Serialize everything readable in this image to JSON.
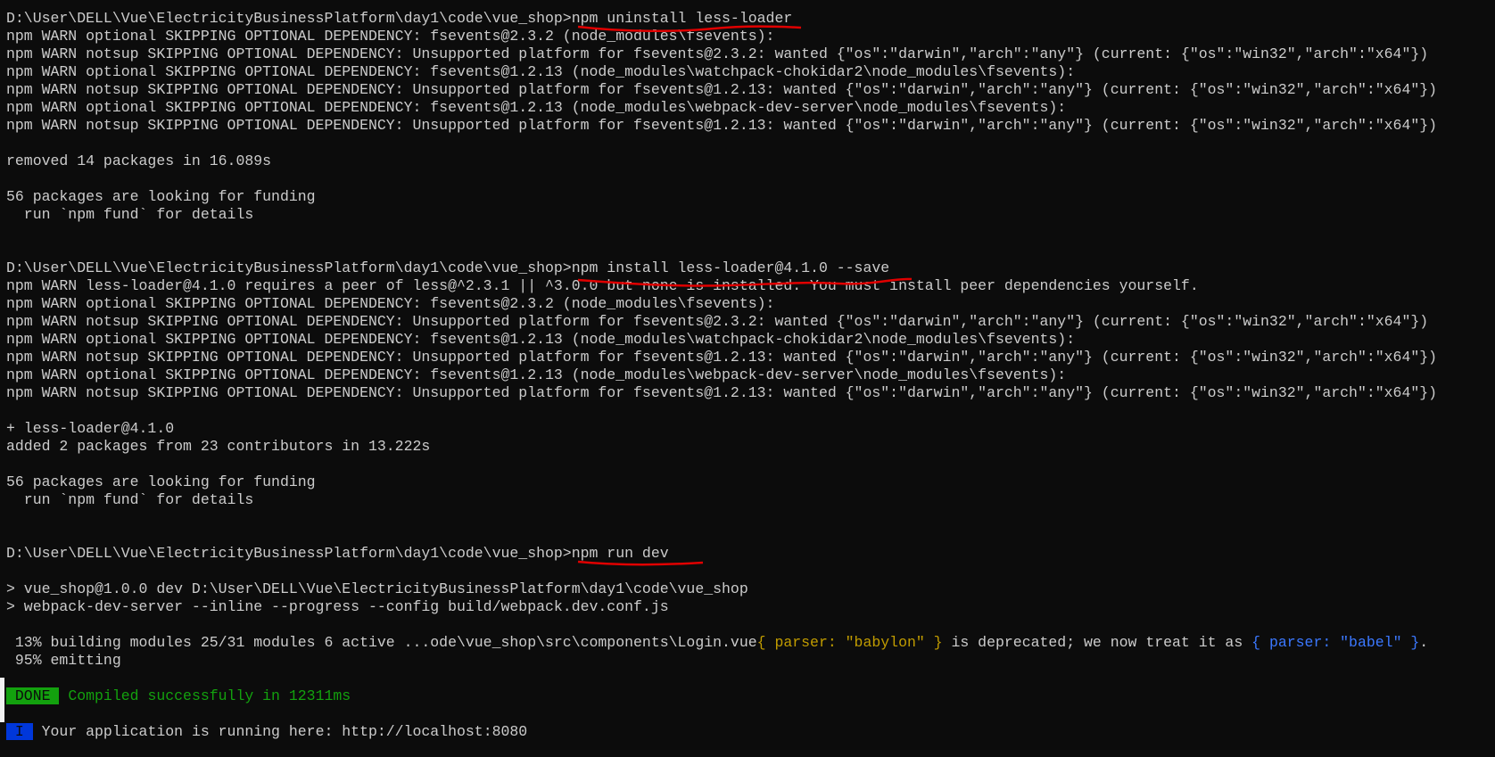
{
  "terminal": {
    "colors": {
      "background": "#0c0c0c",
      "foreground": "#cccccc",
      "yellow": "#c19c00",
      "blue": "#3b78ff",
      "green": "#13a10e",
      "done_badge": "#13a10e",
      "info_badge": "#0037da",
      "annotation": "#e00000"
    },
    "lines": [
      [
        {
          "t": "D:\\User\\DELL\\Vue\\ElectricityBusinessPlatform\\day1\\code\\vue_shop>npm uninstall less-loader"
        }
      ],
      [
        {
          "t": "npm WARN optional SKIPPING OPTIONAL DEPENDENCY: fsevents@2.3.2 (node_modules\\fsevents):"
        }
      ],
      [
        {
          "t": "npm WARN notsup SKIPPING OPTIONAL DEPENDENCY: Unsupported platform for fsevents@2.3.2: wanted {\"os\":\"darwin\",\"arch\":\"any\"} (current: {\"os\":\"win32\",\"arch\":\"x64\"})"
        }
      ],
      [
        {
          "t": "npm WARN optional SKIPPING OPTIONAL DEPENDENCY: fsevents@1.2.13 (node_modules\\watchpack-chokidar2\\node_modules\\fsevents):"
        }
      ],
      [
        {
          "t": "npm WARN notsup SKIPPING OPTIONAL DEPENDENCY: Unsupported platform for fsevents@1.2.13: wanted {\"os\":\"darwin\",\"arch\":\"any\"} (current: {\"os\":\"win32\",\"arch\":\"x64\"})"
        }
      ],
      [
        {
          "t": "npm WARN optional SKIPPING OPTIONAL DEPENDENCY: fsevents@1.2.13 (node_modules\\webpack-dev-server\\node_modules\\fsevents):"
        }
      ],
      [
        {
          "t": "npm WARN notsup SKIPPING OPTIONAL DEPENDENCY: Unsupported platform for fsevents@1.2.13: wanted {\"os\":\"darwin\",\"arch\":\"any\"} (current: {\"os\":\"win32\",\"arch\":\"x64\"})"
        }
      ],
      [],
      [
        {
          "t": "removed 14 packages in 16.089s"
        }
      ],
      [],
      [
        {
          "t": "56 packages are looking for funding"
        }
      ],
      [
        {
          "t": "  run `npm fund` for details"
        }
      ],
      [],
      [],
      [
        {
          "t": "D:\\User\\DELL\\Vue\\ElectricityBusinessPlatform\\day1\\code\\vue_shop>npm install less-loader@4.1.0 --save"
        }
      ],
      [
        {
          "t": "npm WARN less-loader@4.1.0 requires a peer of less@^2.3.1 || ^3.0.0 but none is installed. You must install peer dependencies yourself."
        }
      ],
      [
        {
          "t": "npm WARN optional SKIPPING OPTIONAL DEPENDENCY: fsevents@2.3.2 (node_modules\\fsevents):"
        }
      ],
      [
        {
          "t": "npm WARN notsup SKIPPING OPTIONAL DEPENDENCY: Unsupported platform for fsevents@2.3.2: wanted {\"os\":\"darwin\",\"arch\":\"any\"} (current: {\"os\":\"win32\",\"arch\":\"x64\"})"
        }
      ],
      [
        {
          "t": "npm WARN optional SKIPPING OPTIONAL DEPENDENCY: fsevents@1.2.13 (node_modules\\watchpack-chokidar2\\node_modules\\fsevents):"
        }
      ],
      [
        {
          "t": "npm WARN notsup SKIPPING OPTIONAL DEPENDENCY: Unsupported platform for fsevents@1.2.13: wanted {\"os\":\"darwin\",\"arch\":\"any\"} (current: {\"os\":\"win32\",\"arch\":\"x64\"})"
        }
      ],
      [
        {
          "t": "npm WARN optional SKIPPING OPTIONAL DEPENDENCY: fsevents@1.2.13 (node_modules\\webpack-dev-server\\node_modules\\fsevents):"
        }
      ],
      [
        {
          "t": "npm WARN notsup SKIPPING OPTIONAL DEPENDENCY: Unsupported platform for fsevents@1.2.13: wanted {\"os\":\"darwin\",\"arch\":\"any\"} (current: {\"os\":\"win32\",\"arch\":\"x64\"})"
        }
      ],
      [],
      [
        {
          "t": "+ less-loader@4.1.0"
        }
      ],
      [
        {
          "t": "added 2 packages from 23 contributors in 13.222s"
        }
      ],
      [],
      [
        {
          "t": "56 packages are looking for funding"
        }
      ],
      [
        {
          "t": "  run `npm fund` for details"
        }
      ],
      [],
      [],
      [
        {
          "t": "D:\\User\\DELL\\Vue\\ElectricityBusinessPlatform\\day1\\code\\vue_shop>npm run dev"
        }
      ],
      [],
      [
        {
          "t": "> vue_shop@1.0.0 dev D:\\User\\DELL\\Vue\\ElectricityBusinessPlatform\\day1\\code\\vue_shop"
        }
      ],
      [
        {
          "t": "> webpack-dev-server --inline --progress --config build/webpack.dev.conf.js"
        }
      ],
      [],
      [
        {
          "t": " 13% building modules 25/31 modules 6 active ...ode\\vue_shop\\src\\components\\Login.vue"
        },
        {
          "t": "{ parser: \"babylon\" }",
          "c": "yellow"
        },
        {
          "t": " is deprecated; we now treat it as "
        },
        {
          "t": "{ parser: \"babel\" }",
          "c": "blue"
        },
        {
          "t": "."
        }
      ],
      [
        {
          "t": " 95% emitting"
        }
      ],
      [],
      [
        {
          "t": " DONE ",
          "c": "done-badge"
        },
        {
          "t": " Compiled successfully in 12311ms",
          "c": "green"
        }
      ],
      [],
      [
        {
          "t": " I ",
          "c": "info-badge"
        },
        {
          "t": " Your application is running here: http://localhost:8080"
        }
      ]
    ]
  }
}
